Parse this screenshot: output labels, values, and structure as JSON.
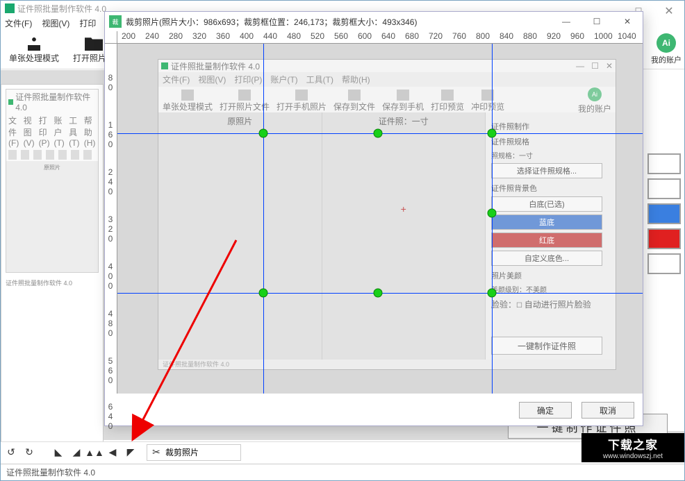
{
  "main": {
    "title": "证件照批量制作软件 4.0",
    "menu": [
      "文件(F)",
      "视图(V)",
      "打印"
    ],
    "toolbar": {
      "single_mode": "单张处理模式",
      "open_photo": "打开照片文",
      "ai_label": "Ai",
      "my_account": "我的账户"
    },
    "right_panel": {
      "one_click": "一键制作证件照"
    },
    "bottombar": {
      "crop_btn": "裁剪照片"
    },
    "status": "证件照批量制作软件 4.0"
  },
  "thumbnail": {
    "title": "证件照批量制作软件 4.0",
    "menu": [
      "文件(F)",
      "视图(V)",
      "打印(P)",
      "账户(T)",
      "工具(T)",
      "帮助(H)"
    ],
    "body_label": "原照片",
    "caption": "证件照批量制作软件 4.0"
  },
  "crop_dialog": {
    "title": "裁剪照片(照片大小：986x693；裁剪框位置：246,173；裁剪框大小：493x346)",
    "icon_text": "裁剪照片",
    "ruler_h": [
      "200",
      "240",
      "280",
      "320",
      "360",
      "400",
      "440",
      "480",
      "520",
      "560",
      "600",
      "640",
      "680",
      "720",
      "760",
      "800",
      "840",
      "880",
      "920",
      "960",
      "1000",
      "1040"
    ],
    "ruler_v": [
      "80",
      "160",
      "240",
      "320",
      "400",
      "480",
      "560",
      "640"
    ],
    "ok": "确定",
    "cancel": "取消"
  },
  "embedded": {
    "title": "证件照批量制作软件 4.0",
    "menu": [
      "文件(F)",
      "视图(V)",
      "打印(P)",
      "账户(T)",
      "工具(T)",
      "帮助(H)"
    ],
    "toolbar": [
      "单张处理模式",
      "打开照片文件",
      "打开手机照片",
      "保存到文件",
      "保存到手机",
      "打印预览",
      "冲印预览"
    ],
    "ai_label": "Ai",
    "my_account": "我的账户",
    "left_head": "原照片",
    "mid_head": "证件照：一寸",
    "right": {
      "panel_title": "证件照制作",
      "spec_group": "证件照规格",
      "spec_label": "照规格：一寸",
      "spec_button": "选择证件照规格...",
      "bg_group": "证件照背景色",
      "white_sel": "白底(已选)",
      "blue": "蓝底",
      "red": "红底",
      "custom": "自定义底色...",
      "beauty_group": "照片美颜",
      "beauty_level": "美颜级别：不美颜",
      "face_label": "脸验：",
      "face_check": "自动进行照片脸验",
      "one_click": "一键制作证件照"
    },
    "status": "证件照批量制作软件 4.0"
  },
  "watermark": {
    "big": "下载之家",
    "small": "www.windowszj.net"
  }
}
